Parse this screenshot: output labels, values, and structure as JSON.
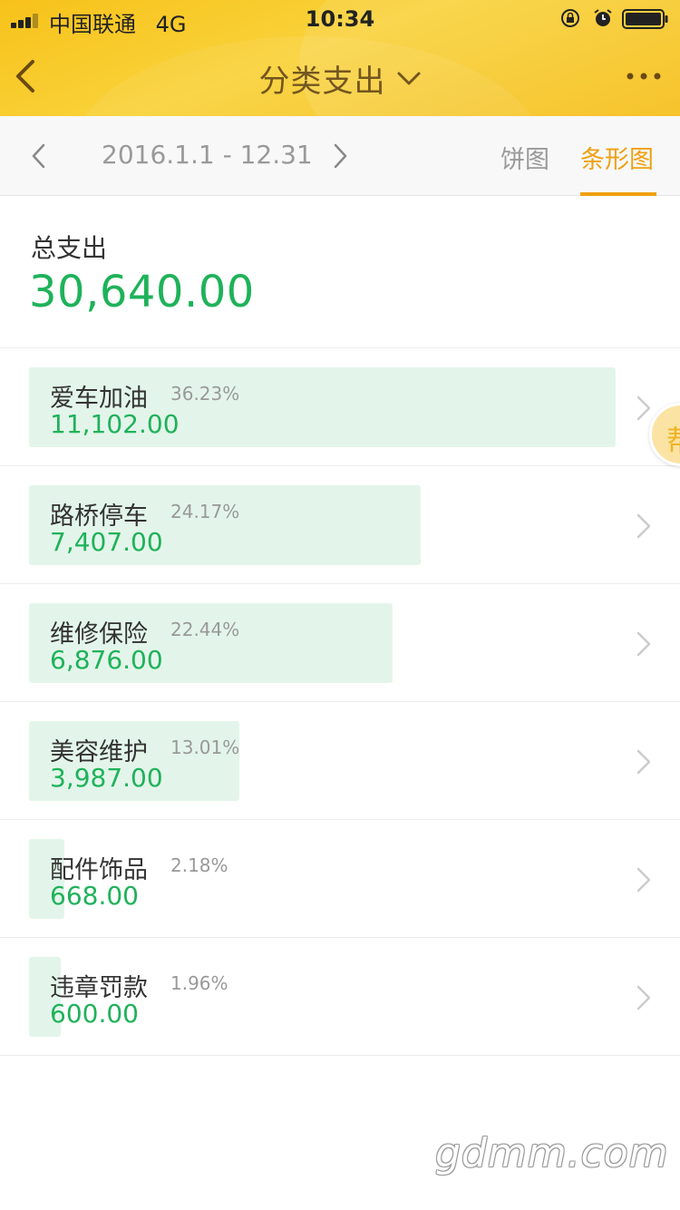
{
  "status_bar": {
    "carrier": "中国联通",
    "network": "4G",
    "time": "10:34",
    "icons": [
      "signal-icon",
      "orientation-lock-icon",
      "alarm-icon",
      "battery-icon"
    ]
  },
  "nav": {
    "title": "分类支出",
    "back_icon": "back-arrow-icon",
    "dropdown_icon": "chevron-down-icon",
    "more_icon": "more-dots-icon"
  },
  "toolbar": {
    "date_range": "2016.1.1 - 12.31",
    "tabs": [
      {
        "label": "饼图",
        "active": false
      },
      {
        "label": "条形图",
        "active": true
      }
    ]
  },
  "total": {
    "label": "总支出",
    "value": "30,640.00"
  },
  "categories": [
    {
      "name": "爱车加油",
      "percent": "36.23%",
      "amount": "11,102.00",
      "share": 36.23
    },
    {
      "name": "路桥停车",
      "percent": "24.17%",
      "amount": "7,407.00",
      "share": 24.17
    },
    {
      "name": "维修保险",
      "percent": "22.44%",
      "amount": "6,876.00",
      "share": 22.44
    },
    {
      "name": "美容维护",
      "percent": "13.01%",
      "amount": "3,987.00",
      "share": 13.01
    },
    {
      "name": "配件饰品",
      "percent": "2.18%",
      "amount": "668.00",
      "share": 2.18
    },
    {
      "name": "违章罚款",
      "percent": "1.96%",
      "amount": "600.00",
      "share": 1.96
    }
  ],
  "floating_help": {
    "label": "帮"
  },
  "watermark": "gdmm.com",
  "colors": {
    "header": "#f7c21a",
    "accent": "#f0a012",
    "amount_green": "#1fb25a",
    "bar_fill": "#e3f5ea"
  }
}
